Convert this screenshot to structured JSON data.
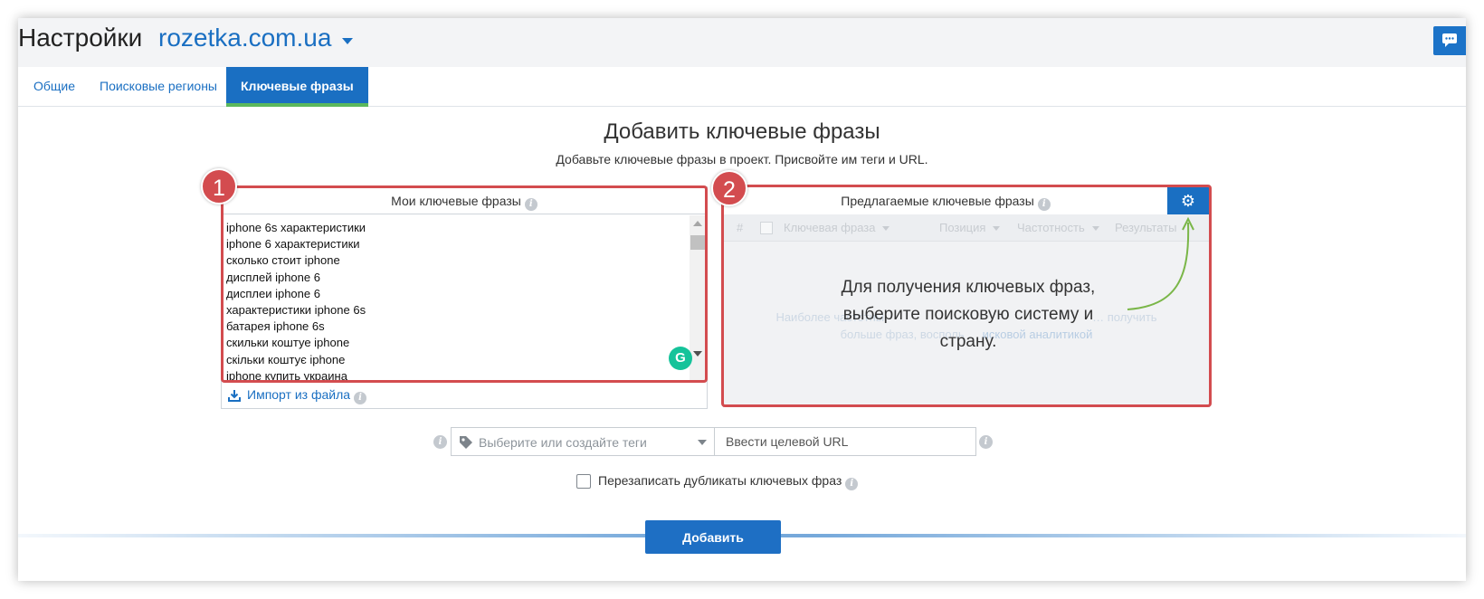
{
  "header": {
    "title": "Настройки",
    "domain": "rozetka.com.ua"
  },
  "tabs": [
    {
      "label": "Общие",
      "active": false
    },
    {
      "label": "Поисковые регионы",
      "active": false
    },
    {
      "label": "Ключевые фразы",
      "active": true
    }
  ],
  "main": {
    "heading": "Добавить ключевые фразы",
    "subtitle": "Добавьте ключевые фразы в проект. Присвойте им теги и URL."
  },
  "my_keywords": {
    "title": "Мои ключевые фразы",
    "items": [
      "iphone 6s характеристики",
      "iphone 6 характеристики",
      "сколько стоит iphone",
      "дисплей iphone 6",
      "дисплеи iphone 6",
      "характеристики iphone 6s",
      "батарея iphone 6s",
      "скильки коштуе iphone",
      "скільки коштує iphone",
      "iphone купить украина"
    ],
    "import_label": "Импорт из файла"
  },
  "suggested": {
    "title": "Предлагаемые ключевые фразы",
    "columns": [
      "#",
      "Ключевая фраза",
      "Позиция",
      "Частотность",
      "Результаты"
    ],
    "faded_text_line1": "Наиболее частотны",
    "faded_text_line1_right": "… получить",
    "faded_text_line2": "больше фраз, восполь",
    "faded_text_line2_link": "исковой аналитикой",
    "overlay": "Для получения ключевых фраз, выберите поисковую систему и страну."
  },
  "annotations": {
    "badge1": "1",
    "badge2": "2"
  },
  "tags": {
    "placeholder": "Выберите или создайте теги"
  },
  "url": {
    "placeholder": "Ввести целевой URL"
  },
  "overwrite_label": "Перезаписать дубликаты ключевых фраз",
  "add_button": "Добавить",
  "colors": {
    "accent": "#1a6fc2",
    "tab_underline": "#5bb85c",
    "annotation_red": "#d34c4f",
    "arrow_green": "#7ab648"
  }
}
